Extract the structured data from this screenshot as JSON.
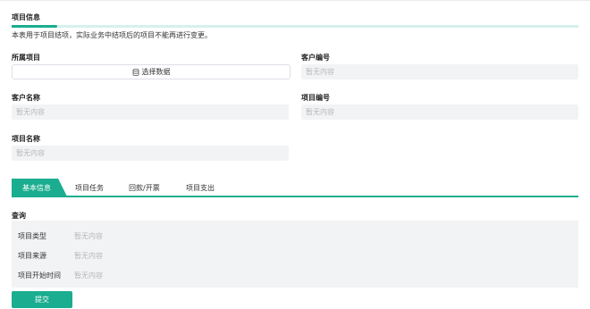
{
  "section": {
    "title": "项目信息",
    "notice": "本表用于项目结项，实际业务中结项后的项目不能再进行变更。"
  },
  "fields": {
    "project": {
      "label": "所属项目",
      "button_label": "选择数据"
    },
    "customer_code": {
      "label": "客户编号",
      "value": "暂无内容"
    },
    "customer_name": {
      "label": "客户名称",
      "value": "暂无内容"
    },
    "project_code": {
      "label": "项目编号",
      "value": "暂无内容"
    },
    "project_name": {
      "label": "项目名称",
      "value": "暂无内容"
    }
  },
  "tabs": [
    {
      "label": "基本信息",
      "active": true
    },
    {
      "label": "项目任务",
      "active": false
    },
    {
      "label": "回款/开票",
      "active": false
    },
    {
      "label": "项目支出",
      "active": false
    }
  ],
  "query": {
    "title": "查询",
    "rows": [
      {
        "label": "项目类型",
        "value": "暂无内容"
      },
      {
        "label": "项目来源",
        "value": "暂无内容"
      },
      {
        "label": "项目开始时间",
        "value": "暂无内容"
      }
    ]
  },
  "actions": {
    "submit_label": "提交"
  },
  "colors": {
    "accent": "#1aad8f",
    "accent_light": "#d6f1ec",
    "field_bg": "#f2f3f5",
    "placeholder": "#b8b8b8"
  }
}
